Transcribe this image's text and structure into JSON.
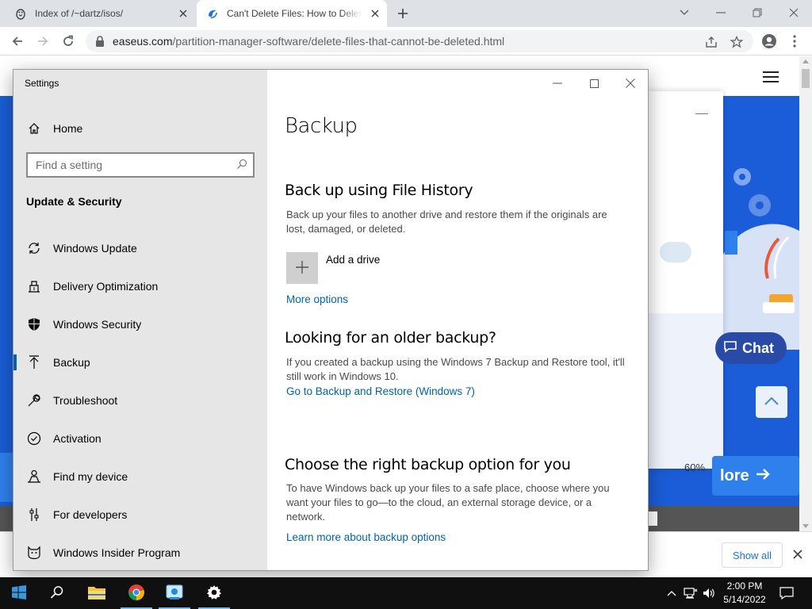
{
  "browser": {
    "tabs": [
      {
        "title": "Index of /~dartz/isos/",
        "icon": "tux-icon"
      },
      {
        "title": "Can't Delete Files: How to Delete",
        "icon": "easeus-icon"
      }
    ],
    "url_host": "easeus.com",
    "url_path": "/partition-manager-software/delete-files-that-cannot-be-deleted.html"
  },
  "webpage": {
    "chat_label": "Chat",
    "more_label": "lore",
    "popup_percent": "60%"
  },
  "download_shelf": {
    "show_all_label": "Show all"
  },
  "settings": {
    "window_title": "Settings",
    "home_label": "Home",
    "search_placeholder": "Find a setting",
    "section_title": "Update & Security",
    "nav": [
      {
        "label": "Windows Update",
        "icon": "sync-icon"
      },
      {
        "label": "Delivery Optimization",
        "icon": "delivery-icon"
      },
      {
        "label": "Windows Security",
        "icon": "shield-icon"
      },
      {
        "label": "Backup",
        "icon": "backup-arrow-icon",
        "active": true
      },
      {
        "label": "Troubleshoot",
        "icon": "wrench-icon"
      },
      {
        "label": "Activation",
        "icon": "check-circle-icon"
      },
      {
        "label": "Find my device",
        "icon": "person-locate-icon"
      },
      {
        "label": "For developers",
        "icon": "developer-sliders-icon"
      },
      {
        "label": "Windows Insider Program",
        "icon": "insider-cat-icon"
      }
    ],
    "content": {
      "page_title": "Backup",
      "file_history_heading": "Back up using File History",
      "file_history_desc": "Back up your files to another drive and restore them if the originals are lost, damaged, or deleted.",
      "add_drive_label": "Add a drive",
      "more_options_link": "More options",
      "older_backup_heading": "Looking for an older backup?",
      "older_backup_desc": "If you created a backup using the Windows 7 Backup and Restore tool, it'll still work in Windows 10.",
      "backup_restore_link": "Go to Backup and Restore (Windows 7)",
      "choose_heading": "Choose the right backup option for you",
      "choose_desc": "To have Windows back up your files to a safe place, choose where you want your files to go—to the cloud, an external storage device, or a network.",
      "learn_more_link": "Learn more about backup options"
    }
  },
  "taskbar": {
    "time": "2:00 PM",
    "date": "5/14/2022"
  },
  "colors": {
    "accent": "#0063b1",
    "sidebar_bg": "#e6e6e6",
    "taskbar_bg": "#101010",
    "page_blue": "#1b5dd8"
  }
}
